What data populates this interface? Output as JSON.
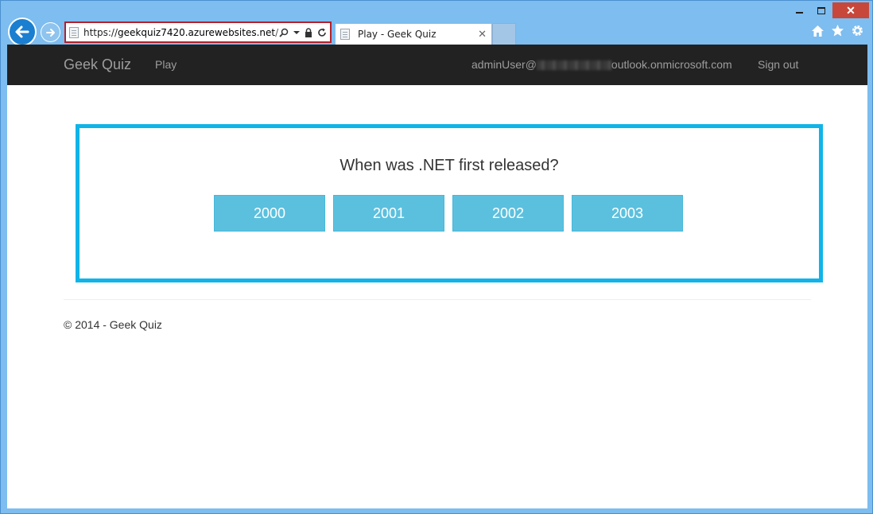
{
  "browser": {
    "address": {
      "scheme": "https://",
      "host": "geekquiz7420.azurewebsites.net",
      "path": "/"
    },
    "tab": {
      "title": "Play - Geek Quiz",
      "close_glyph": "✕"
    },
    "window_controls": {
      "close_glyph": "✕"
    },
    "icons": [
      "back-arrow-icon",
      "forward-arrow-icon",
      "search-icon",
      "lock-icon",
      "refresh-icon",
      "home-icon",
      "favorites-star-icon",
      "gear-icon"
    ]
  },
  "navbar": {
    "brand": "Geek Quiz",
    "play_link": "Play",
    "user_prefix": "adminUser@",
    "user_suffix": "outlook.onmicrosoft.com",
    "signout_link": "Sign out"
  },
  "quiz": {
    "question": "When was .NET first released?",
    "options": [
      "2000",
      "2001",
      "2002",
      "2003"
    ]
  },
  "footer": {
    "copyright": "© 2014 - Geek Quiz"
  },
  "colors": {
    "navbar_bg": "#222222",
    "quiz_border": "#10b4e8",
    "option_bg": "#5bc0de",
    "browser_chrome": "#7dbdf0"
  }
}
